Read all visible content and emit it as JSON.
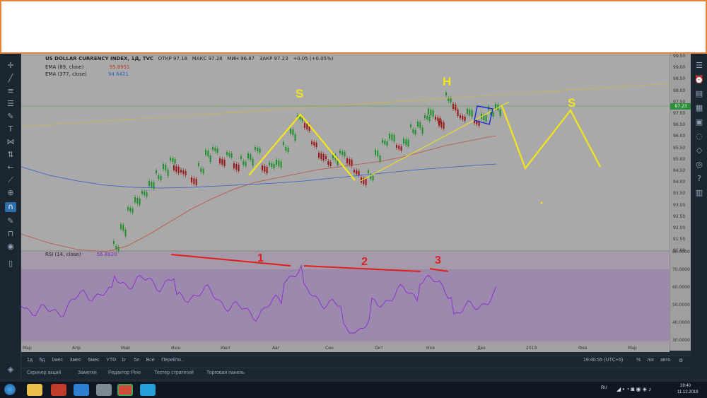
{
  "chart": {
    "symbol": "US DOLLAR CURRENCY INDEX, 1Д, TVC",
    "open": "ОТКР 97.18",
    "high": "МАКС 97.28",
    "low": "МИН 96.87",
    "close": "ЗАКР 97.23",
    "change": "+0.05 (+0.05%)",
    "ema1_label": "EMA (89, close)",
    "ema1_value": "95.8951",
    "ema2_label": "EMA (377, close)",
    "ema2_value": "94.6421",
    "rsi_label": "RSI (14, close)",
    "rsi_value": "56.8920",
    "last_price": "97.23"
  },
  "price_axis": [
    "99.50",
    "99.00",
    "98.50",
    "98.00",
    "97.50",
    "97.00",
    "96.50",
    "96.00",
    "95.50",
    "95.00",
    "94.50",
    "94.00",
    "93.50",
    "93.00",
    "92.50",
    "92.00",
    "91.50",
    "91.00"
  ],
  "rsi_axis": [
    "80.0000",
    "70.0000",
    "60.0000",
    "50.0000",
    "40.0000",
    "30.0000"
  ],
  "time_axis": [
    "Мар",
    "Апр",
    "Май",
    "Июн",
    "Июл",
    "Авг",
    "Сен",
    "Окт",
    "Ноя",
    "Дек",
    "2019",
    "Фев",
    "Мар"
  ],
  "annotations": {
    "left_shoulder": "S",
    "head": "H",
    "right_shoulder": "S",
    "div1": "1",
    "div2": "2",
    "div3": "3"
  },
  "ranges": [
    "1д",
    "5д",
    "1мес",
    "3мес",
    "6мес",
    "YTD",
    "1г",
    "5л",
    "Все",
    "Перейти..."
  ],
  "clock": "19:40:55 (UTC+5)",
  "scale_options": [
    "%",
    "лог",
    "авто"
  ],
  "tabs": [
    "Скринер акций",
    "Заметки",
    "Редактор Pine",
    "Тестер стратегий",
    "Торговая панель"
  ],
  "tray": {
    "lang": "RU",
    "time": "19:40",
    "date": "11.12.2018"
  },
  "colors": {
    "up": "#1e8f2a",
    "down": "#9a1515",
    "pattern": "#f2e61a",
    "divergence": "#e21d1d",
    "rsi_line": "#8a2bd0",
    "ema89": "#c0503a",
    "ema377": "#2e5ec9"
  }
}
